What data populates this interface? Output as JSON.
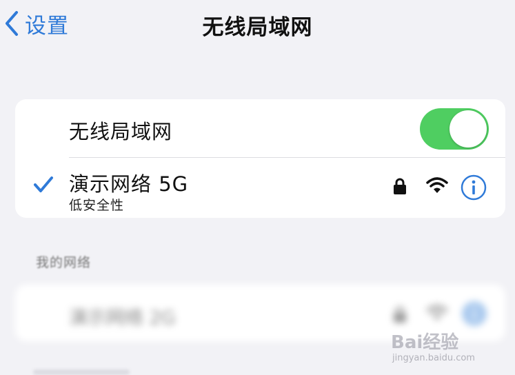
{
  "nav": {
    "back_label": "设置",
    "title": "无线局域网"
  },
  "wifi_toggle": {
    "label": "无线局域网",
    "on": true
  },
  "current_network": {
    "name": "演示网络 5G",
    "security": "低安全性"
  },
  "my_networks": {
    "header": "我的网络",
    "items": [
      {
        "name": "演示网络 2G"
      }
    ]
  },
  "watermark": {
    "logo": "Bai经验",
    "url": "jingyan.baidu.com"
  },
  "colors": {
    "accent": "#2f7ad8",
    "toggle_on": "#4fce61",
    "background": "#f2f2f6",
    "card": "#ffffff"
  },
  "icons": [
    "chevron-left-icon",
    "checkmark-icon",
    "lock-icon",
    "wifi-icon",
    "info-icon"
  ]
}
